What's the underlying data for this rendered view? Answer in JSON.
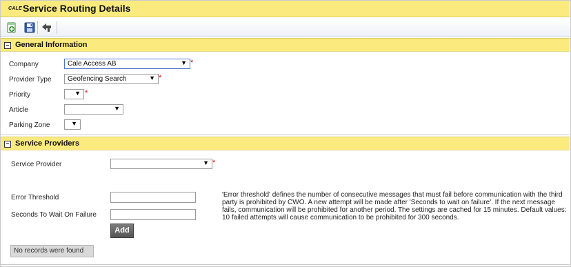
{
  "app": {
    "logo_text": "CALE",
    "title": "Service Routing Details"
  },
  "toolbar": {
    "buttons": [
      {
        "icon": "add-document-icon"
      },
      {
        "icon": "save-icon"
      },
      {
        "icon": "back-arrow-icon"
      }
    ]
  },
  "general": {
    "title": "General Information",
    "fields": {
      "company": {
        "label": "Company",
        "value": "Cale Access AB",
        "required": "*"
      },
      "provider_type": {
        "label": "Provider Type",
        "value": "Geofencing Search",
        "required": "*"
      },
      "priority": {
        "label": "Priority",
        "value": "",
        "required": "*"
      },
      "article": {
        "label": "Article",
        "value": ""
      },
      "parking_zone": {
        "label": "Parking Zone",
        "value": ""
      }
    }
  },
  "providers": {
    "title": "Service Providers",
    "service_provider": {
      "label": "Service Provider",
      "value": "",
      "required": "*"
    },
    "error_threshold": {
      "label": "Error Threshold",
      "value": ""
    },
    "seconds_wait": {
      "label": "Seconds To Wait On Failure",
      "value": ""
    },
    "note": "'Error threshold' defines the number of consecutive messages that must fail before communication with the third party is prohibited by CWO. A new attempt will be made after 'Seconds to wait on failure'. If the next message fails, communication will be prohibited for another period. The settings are cached for 15 minutes. Default values: 10 failed attempts will cause communication to be prohibited for 300 seconds.",
    "add_label": "Add",
    "empty_message": "No records were found"
  },
  "dropdown_caret": "▼"
}
